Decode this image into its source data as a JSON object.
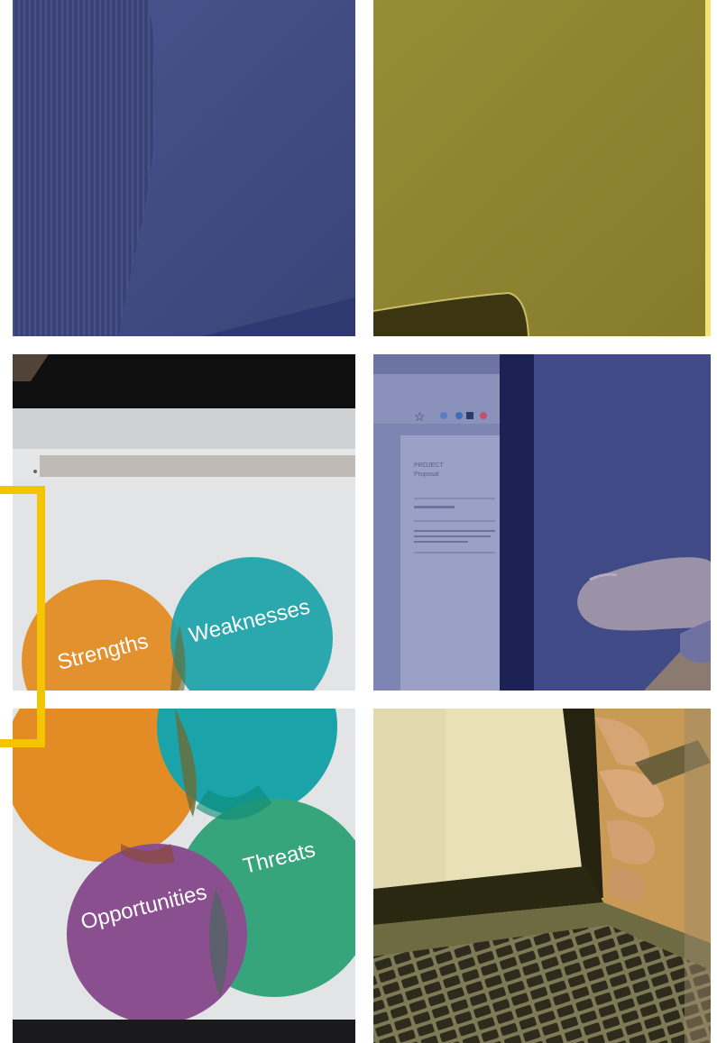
{
  "swot": {
    "strengths": "Strengths",
    "weaknesses": "Weaknesses",
    "opportunities": "Opportunities",
    "threats": "Threats"
  },
  "browser_panel": {
    "title_line1": "PROJECT",
    "title_line2": "Proposal"
  },
  "colors": {
    "navy_overlay": "#3f4a86",
    "olive_overlay": "#8d8430",
    "accent_yellow": "#f5c400",
    "strengths": "#e38c25",
    "weaknesses": "#1aa3a8",
    "opportunities": "#8a4f8e",
    "threats": "#37a57c"
  }
}
